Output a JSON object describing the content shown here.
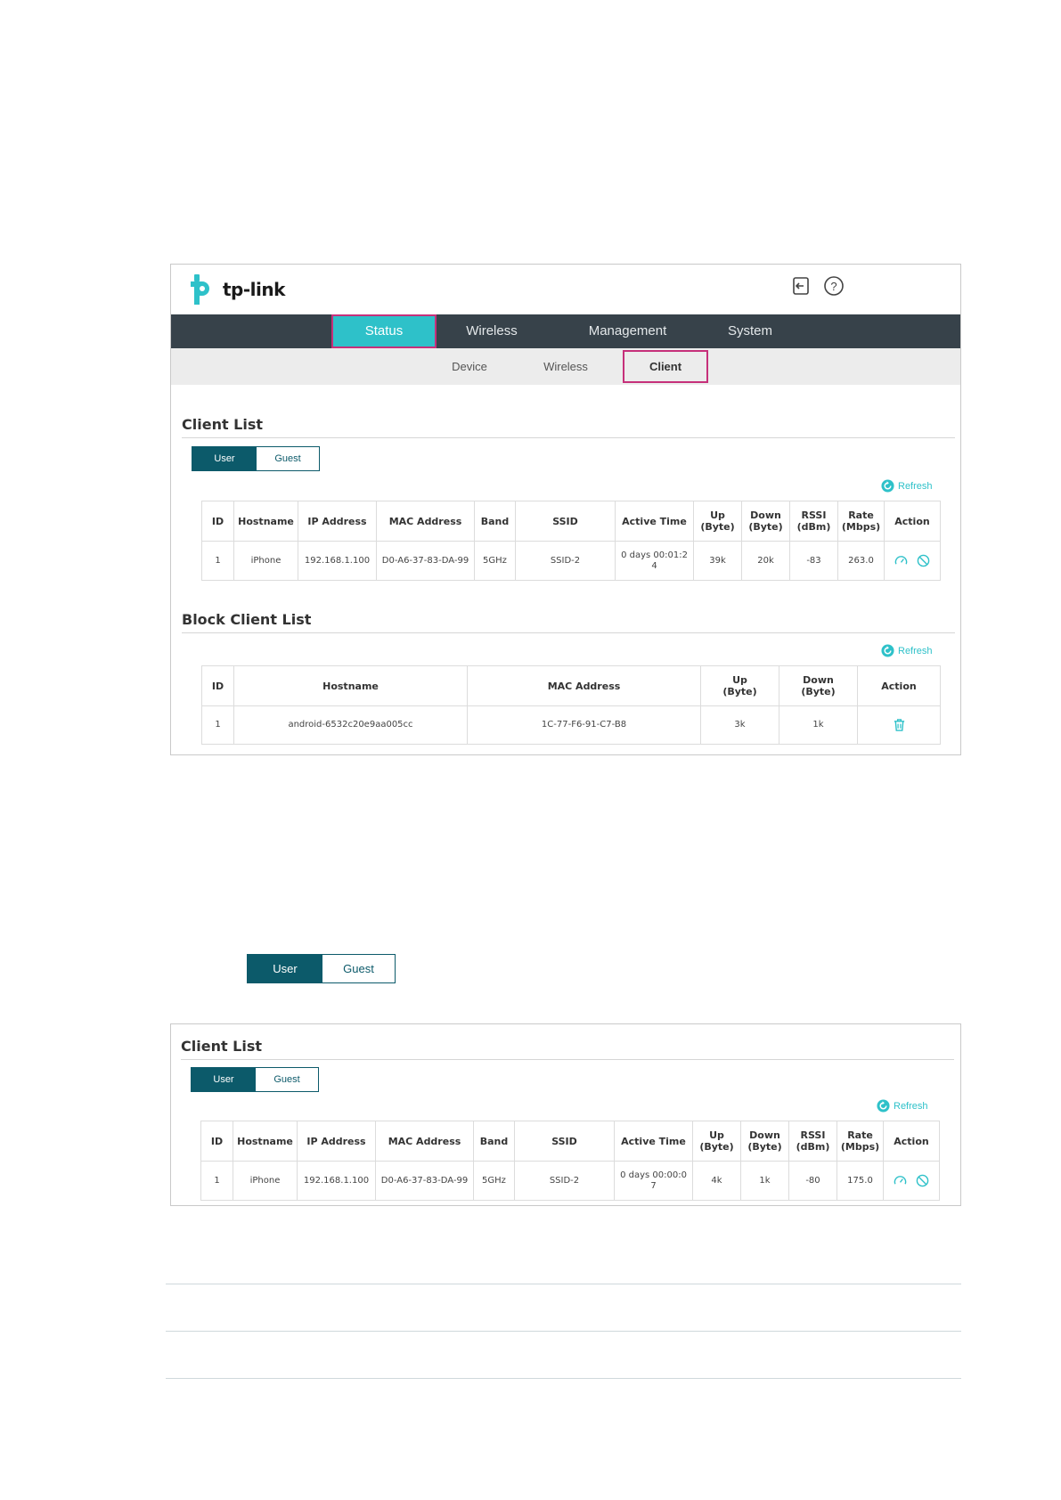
{
  "brand": {
    "logo_text": "tp-link",
    "accent": "#2ec1c9",
    "nav_bg": "#37424a",
    "tab_active": "#0c5a6a",
    "highlight": "#c6307a"
  },
  "header": {
    "logout_icon": "logout-icon",
    "help_icon": "help-icon"
  },
  "topnav": [
    "Status",
    "Wireless",
    "Management",
    "System"
  ],
  "subnav": [
    "Device",
    "Wireless",
    "Client"
  ],
  "client_list": {
    "title": "Client List",
    "tabs": [
      "User",
      "Guest"
    ],
    "refresh": "Refresh",
    "headers": [
      "ID",
      "Hostname",
      "IP Address",
      "MAC Address",
      "Band",
      "SSID",
      "Active Time",
      "Up\n(Byte)",
      "Down\n(Byte)",
      "RSSI\n(dBm)",
      "Rate\n(Mbps)",
      "Action"
    ],
    "rows": [
      [
        "1",
        "iPhone",
        "192.168.1.100",
        "D0-A6-37-83-DA-99",
        "5GHz",
        "SSID-2",
        "0 days 00:01:2\n4",
        "39k",
        "20k",
        "-83",
        "263.0"
      ]
    ]
  },
  "block_list": {
    "title": "Block Client List",
    "refresh": "Refresh",
    "headers": [
      "ID",
      "Hostname",
      "MAC Address",
      "Up\n(Byte)",
      "Down\n(Byte)",
      "Action"
    ],
    "rows": [
      [
        "1",
        "android-6532c20e9aa005cc",
        "1C-77-F6-91-C7-B8",
        "3k",
        "1k"
      ]
    ]
  },
  "standalone_tabs": [
    "User",
    "Guest"
  ],
  "client_list_2": {
    "title": "Client List",
    "tabs": [
      "User",
      "Guest"
    ],
    "refresh": "Refresh",
    "headers": [
      "ID",
      "Hostname",
      "IP Address",
      "MAC Address",
      "Band",
      "SSID",
      "Active Time",
      "Up\n(Byte)",
      "Down\n(Byte)",
      "RSSI\n(dBm)",
      "Rate\n(Mbps)",
      "Action"
    ],
    "rows": [
      [
        "1",
        "iPhone",
        "192.168.1.100",
        "D0-A6-37-83-DA-99",
        "5GHz",
        "SSID-2",
        "0 days 00:00:0\n7",
        "4k",
        "1k",
        "-80",
        "175.0"
      ]
    ]
  }
}
